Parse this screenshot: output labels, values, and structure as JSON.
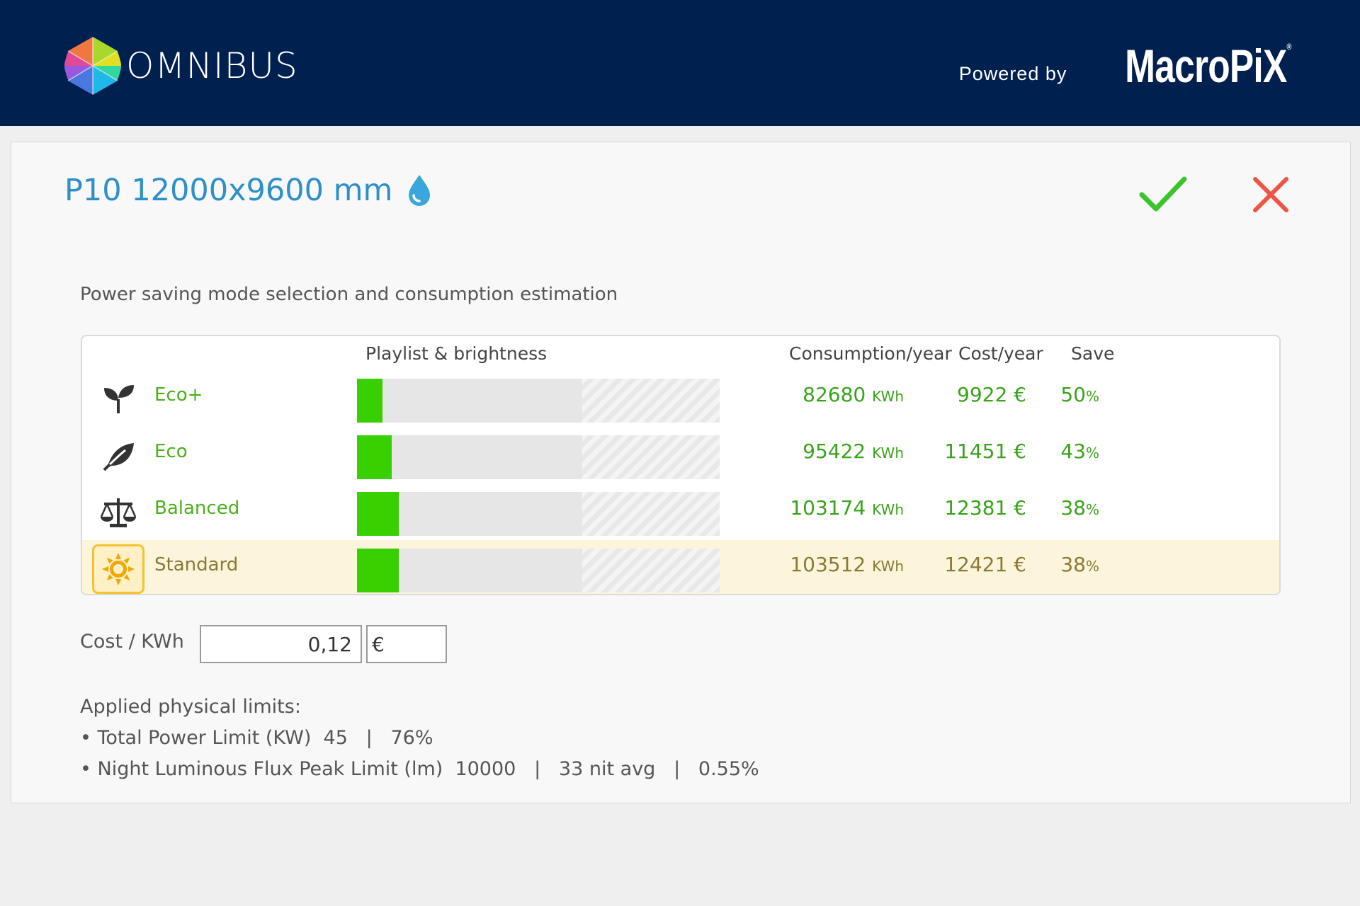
{
  "header": {
    "app_name": "OMNIBUS",
    "powered_by": "Powered by",
    "brand": "MacroPiX",
    "brand_mark": "®"
  },
  "dialog": {
    "title": "P10 12000x9600 mm",
    "title_icon": "water-drop-icon",
    "confirm_icon": "checkmark-icon",
    "cancel_icon": "close-icon",
    "subtitle": "Power saving mode selection and consumption estimation",
    "columns": {
      "playlist": "Playlist & brightness",
      "consumption": "Consumption/year",
      "cost": "Cost/year",
      "save": "Save"
    },
    "modes": [
      {
        "icon": "sprout-icon",
        "label": "Eco+",
        "consumption": "82680",
        "consumption_unit": "KWh",
        "cost": "9922 €",
        "save": "50",
        "save_unit": "%",
        "brightness": 0.07,
        "selected": false
      },
      {
        "icon": "leaf-icon",
        "label": "Eco",
        "consumption": "95422",
        "consumption_unit": "KWh",
        "cost": "11451 €",
        "save": "43",
        "save_unit": "%",
        "brightness": 0.095,
        "selected": false
      },
      {
        "icon": "balance-scale-icon",
        "label": "Balanced",
        "consumption": "103174",
        "consumption_unit": "KWh",
        "cost": "12381 €",
        "save": "38",
        "save_unit": "%",
        "brightness": 0.115,
        "selected": false
      },
      {
        "icon": "sun-icon",
        "label": "Standard",
        "consumption": "103512",
        "consumption_unit": "KWh",
        "cost": "12421 €",
        "save": "38",
        "save_unit": "%",
        "brightness": 0.115,
        "selected": true
      }
    ],
    "cost_per_kwh": {
      "label": "Cost / KWh",
      "value": "0,12",
      "currency": "€"
    },
    "limits": {
      "title": "Applied physical limits:",
      "line1": "• Total Power Limit (KW)  45   |   76%",
      "line2": "• Night Luminous Flux Peak Limit (lm)  10000   |   33 nit avg   |   0.55%"
    },
    "colors": {
      "header_bg": "#002050",
      "accent_blue": "#2f8fc8",
      "green_value": "#3aa31c",
      "bar_green": "#39d000",
      "selected_bg": "#fdf4dc",
      "confirm": "#3cc42c",
      "cancel": "#ee5544"
    }
  }
}
